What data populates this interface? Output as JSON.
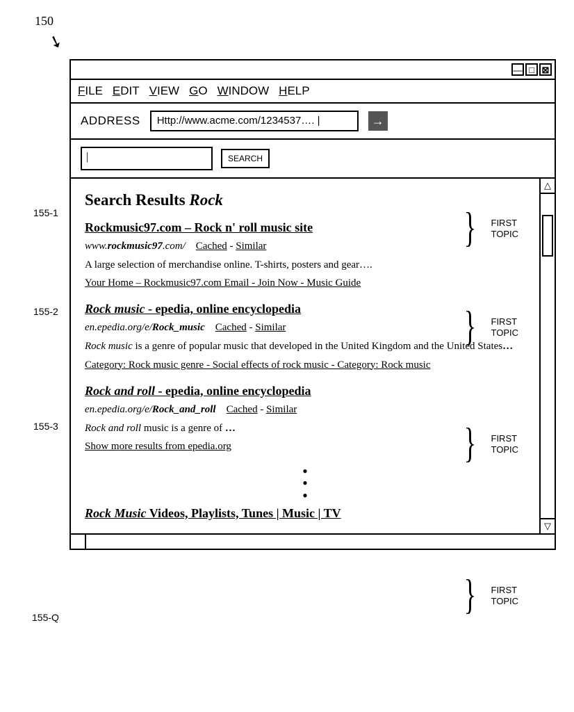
{
  "figure_label": "150",
  "menubar": {
    "file": "FILE",
    "edit": "EDIT",
    "view": "VIEW",
    "go": "GO",
    "window": "WINDOW",
    "help": "HELP"
  },
  "address": {
    "label": "ADDRESS",
    "value": "Http://www.acme.com/1234537…. |"
  },
  "search": {
    "button": "SEARCH"
  },
  "results_heading_prefix": "Search Results ",
  "results_heading_term": "Rock",
  "left_annots": {
    "r1": "155-1",
    "r2": "155-2",
    "r3": "155-3",
    "rq": "155-Q"
  },
  "topic_label": "FIRST\nTOPIC",
  "results": [
    {
      "title_html": "Rockmusic97.com – Rock n' roll music site",
      "url_prefix": "www.",
      "url_bold": "rockmusic97",
      "url_suffix": ".com/",
      "cached": "Cached",
      "similar": "Similar",
      "snippet": "A large selection of merchandise online. T-shirts, posters and gear….",
      "links": "Your Home – Rockmusic97.com Email - Join Now - Music Guide"
    },
    {
      "title_italic": "Rock music",
      "title_rest": " - epedia, online encyclopedia",
      "url_prefix": "en.epedia.org/e/",
      "url_bold": "Rock_music",
      "url_suffix": "",
      "cached": "Cached",
      "similar": "Similar",
      "snippet_italic": "Rock music",
      "snippet_rest": " is a genre of popular music that developed in the United Kingdom and the United States",
      "snippet_ellipsis": "…",
      "links": "Category: Rock music genre - Social effects of rock music - Category: Rock music"
    },
    {
      "title_italic": "Rock and roll",
      "title_rest": " - epedia, online encyclopedia",
      "url_prefix": "en.epedia.org/e/",
      "url_bold": "Rock_and_roll",
      "url_suffix": "",
      "cached": "Cached",
      "similar": "Similar",
      "snippet_italic": "Rock and roll",
      "snippet_rest": " music is a genre of ",
      "snippet_ellipsis": "…",
      "show_more": "Show more results from epedia.org"
    },
    {
      "title_italic": "Rock Music",
      "title_rest": " Videos, Playlists, Tunes | Music | TV"
    }
  ]
}
